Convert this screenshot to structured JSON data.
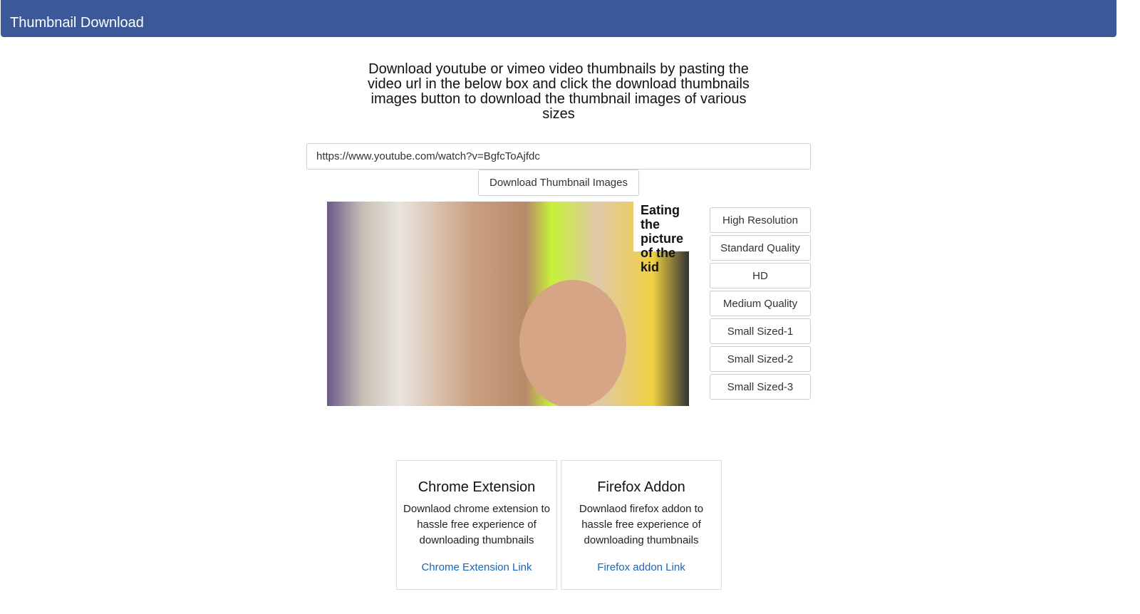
{
  "header": {
    "title": "Thumbnail Download",
    "color": "#3b5998"
  },
  "intro": "Download youtube or vimeo video thumbnails by pasting the video url in the below box and click the download thumbnails images button to download the thumbnail images of various sizes",
  "url_input": {
    "value": "https://www.youtube.com/watch?v=BgfcToAjfdc"
  },
  "download_button": "Download Thumbnail Images",
  "thumbnail": {
    "caption": "Eating the picture of the kid"
  },
  "quality_buttons": [
    "High Resolution",
    "Standard Quality",
    "HD",
    "Medium Quality",
    "Small Sized-1",
    "Small Sized-2",
    "Small Sized-3"
  ],
  "cards": [
    {
      "title": "Chrome Extension",
      "text": "Downlaod chrome extension to hassle free experience of downloading thumbnails",
      "link": "Chrome Extension Link"
    },
    {
      "title": "Firefox Addon",
      "text": "Downlaod firefox addon to hassle free experience of downloading thumbnails",
      "link": "Firefox addon Link"
    }
  ]
}
